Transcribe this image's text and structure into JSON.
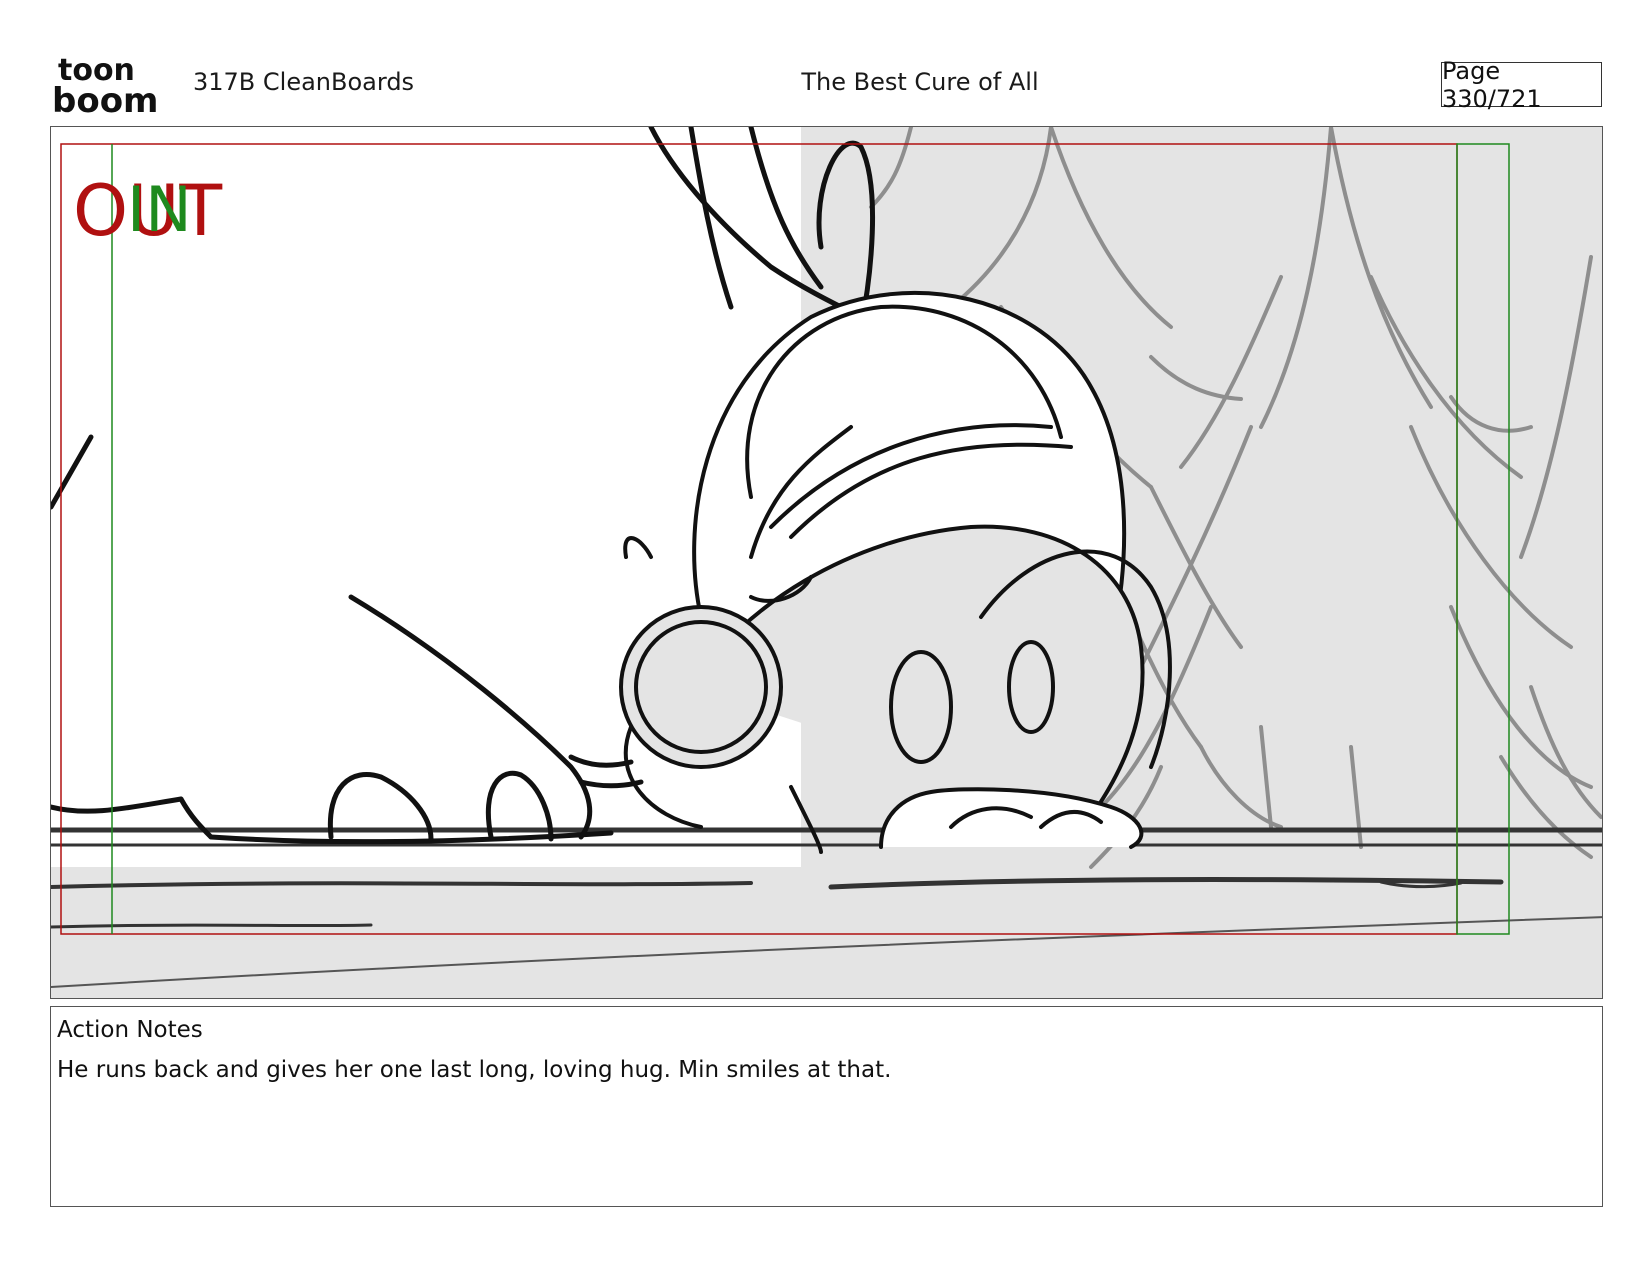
{
  "header": {
    "logo_line1": "toon",
    "logo_line2": "boom",
    "production": "317B  CleanBoards",
    "title": "The Best Cure of All",
    "page": "Page 330/721"
  },
  "panel": {
    "out_label": "OUT",
    "in_label": "IN",
    "colors": {
      "out_frame": "#b01010",
      "in_frame": "#1e8a1e",
      "background_fill": "#e4e4e4",
      "tree_stroke": "#8e8e8e",
      "ink": "#111111"
    }
  },
  "notes": {
    "heading": "Action Notes",
    "text": "He runs back and gives her one last long, loving hug. Min smiles at that."
  }
}
